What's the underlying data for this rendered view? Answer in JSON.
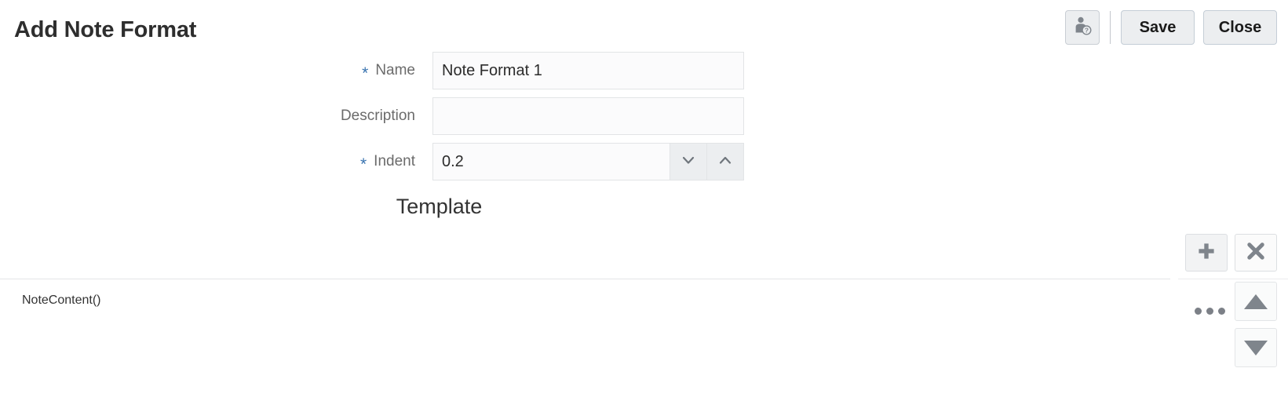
{
  "header": {
    "title": "Add Note Format",
    "help_icon": "person-help-icon",
    "save_label": "Save",
    "close_label": "Close"
  },
  "form": {
    "fields": [
      {
        "label": "Name",
        "required": true,
        "value": "Note Format 1",
        "placeholder": ""
      },
      {
        "label": "Description",
        "required": false,
        "value": "",
        "placeholder": ""
      },
      {
        "label": "Indent",
        "required": true,
        "value": "0.2",
        "placeholder": ""
      }
    ],
    "required_marker": "*"
  },
  "spinner": {
    "decrement_icon": "chevron-down-icon",
    "increment_icon": "chevron-up-icon"
  },
  "template": {
    "heading": "Template",
    "toolbar": {
      "add_icon": "plus-icon",
      "delete_icon": "close-x-icon"
    },
    "rows": [
      {
        "label": "NoteContent()"
      }
    ],
    "row_menu_icon": "ellipsis-icon",
    "reorder": {
      "move_up_icon": "triangle-up-icon",
      "move_down_icon": "triangle-down-icon"
    }
  },
  "colors": {
    "required_star": "#3a74b0",
    "button_face": "#eceef0",
    "text_primary": "#2e2e2e",
    "label_gray": "#6b6b6b",
    "icon_gray": "#7f858c"
  }
}
